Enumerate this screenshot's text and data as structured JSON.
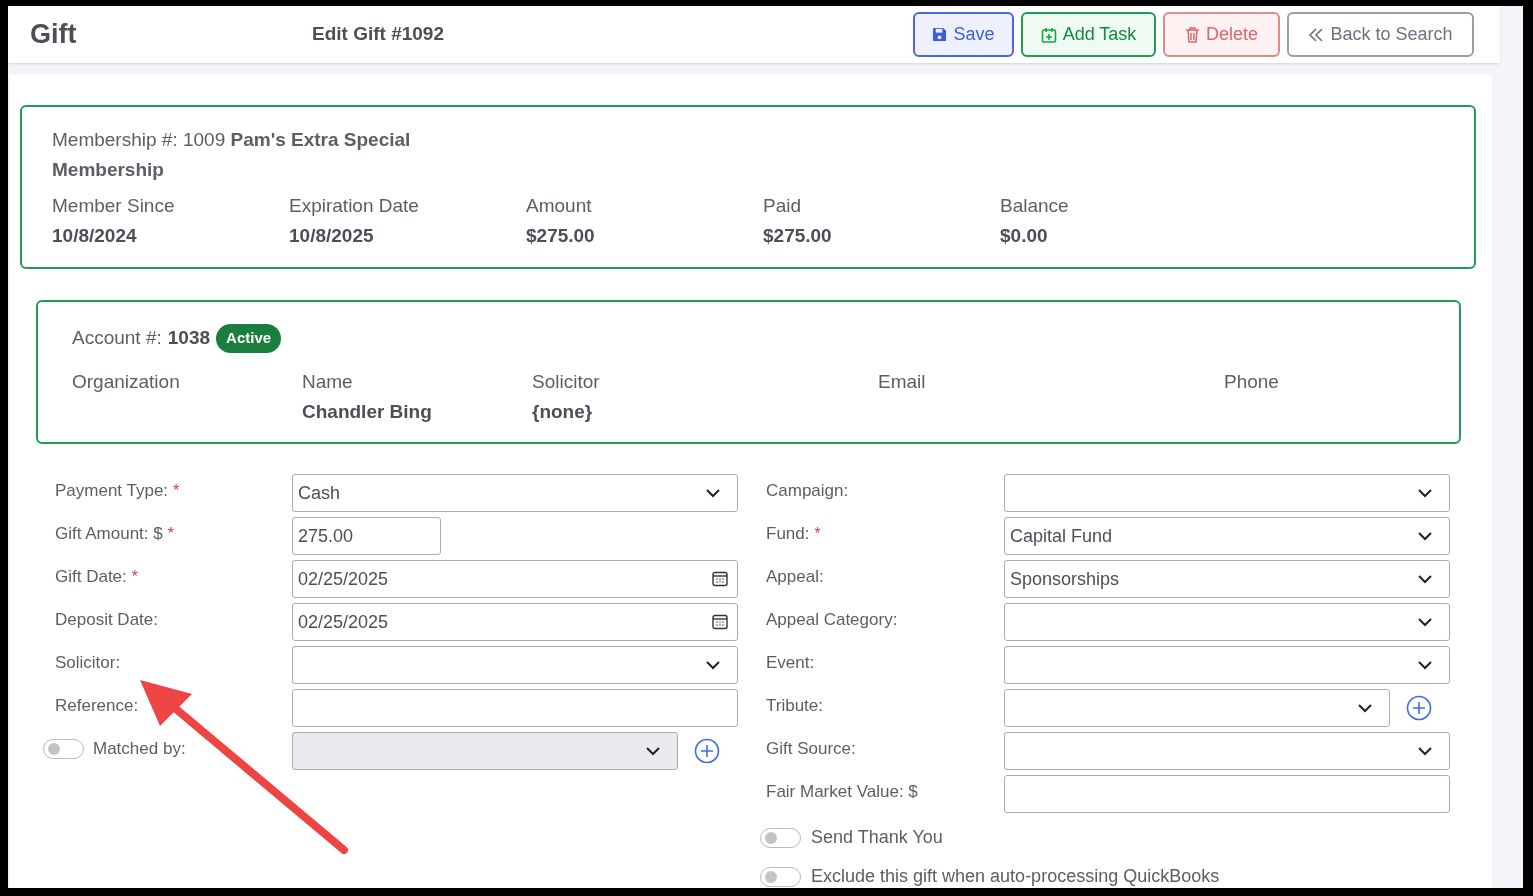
{
  "header": {
    "title": "Gift",
    "subtitle": "Edit Gift #1092",
    "buttons": [
      {
        "label": "Save",
        "kind": "save"
      },
      {
        "label": "Add Task",
        "kind": "task"
      },
      {
        "label": "Delete",
        "kind": "delete"
      },
      {
        "label": "Back to Search",
        "kind": "back"
      }
    ]
  },
  "membership": {
    "title": "Membership #: 1009 **Pam's Extra Special Membership**",
    "stats": [
      {
        "label": "Member Since",
        "value": "10/8/2024"
      },
      {
        "label": "Expiration Date",
        "value": "10/8/2025"
      },
      {
        "label": "Amount",
        "value": "$275.00"
      },
      {
        "label": "Paid",
        "value": "$275.00"
      },
      {
        "label": "Balance",
        "value": "$0.00"
      }
    ]
  },
  "account": {
    "label": "Account #:",
    "number": "1038",
    "badge": "Active",
    "columns": [
      {
        "label": "Organization"
      },
      {
        "label": "Name",
        "value": "Chandler Bing"
      },
      {
        "label": "Solicitor",
        "value": "{none}"
      },
      {
        "label": "Email"
      },
      {
        "label": "Phone"
      }
    ]
  },
  "left_fields": [
    {
      "label": "Payment Type:",
      "required_mark": "*",
      "kind": "select",
      "value": "Cash"
    },
    {
      "label": "Gift Amount: $",
      "required_mark": "*",
      "kind": "amount",
      "value": "275.00"
    },
    {
      "label": "Gift Date:",
      "required_mark": "*",
      "kind": "date",
      "value": "02/25/2025"
    },
    {
      "label": "Deposit Date:",
      "kind": "date",
      "value": "02/25/2025"
    },
    {
      "label": "Solicitor:",
      "kind": "select"
    },
    {
      "label": "Reference:",
      "kind": "text"
    },
    {
      "label": "Matched by:",
      "kind": "select",
      "toggle": {
        "on": false
      },
      "disabled": true,
      "add_button": true
    }
  ],
  "right_fields": [
    {
      "label": "Campaign:",
      "kind": "select"
    },
    {
      "label": "Fund:",
      "required_mark": "*",
      "kind": "select",
      "value": "Capital Fund"
    },
    {
      "label": "Appeal:",
      "kind": "select",
      "value": "Sponsorships"
    },
    {
      "label": "Appeal Category:",
      "kind": "select"
    },
    {
      "label": "Event:",
      "kind": "select"
    },
    {
      "label": "Tribute:",
      "kind": "select",
      "add_button": true
    },
    {
      "label": "Gift Source:",
      "kind": "select"
    },
    {
      "label": "Fair Market Value: $",
      "kind": "text"
    }
  ],
  "switches": [
    {
      "label": "Send Thank You",
      "on": false
    },
    {
      "label": "Exclude this gift when auto-processing QuickBooks",
      "on": false
    }
  ]
}
